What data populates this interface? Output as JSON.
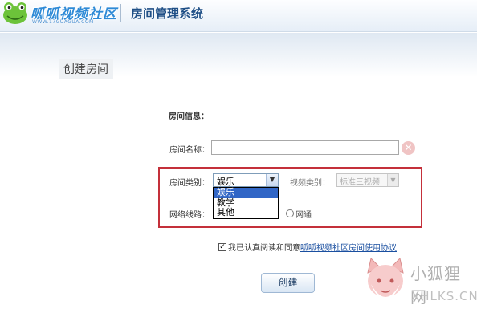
{
  "header": {
    "brand_name": "呱呱视频社区",
    "brand_url": "WWW.17GUAGUA.COM",
    "system_title": "房间管理系统"
  },
  "page": {
    "section_title": "创建房间"
  },
  "form": {
    "room_info_label": "房间信息：",
    "room_name_label": "房间名称：",
    "room_name_value": "",
    "room_category_label": "房间类别：",
    "room_category_value": "娱乐",
    "room_category_options": [
      "娱乐",
      "教学",
      "其他"
    ],
    "video_category_label": "视频类别：",
    "video_category_value": "标准三视频",
    "network_label": "网络线路：",
    "network_option_label": "网通"
  },
  "agreement": {
    "checked": true,
    "text": "我已认真阅读和同意",
    "link_text": "呱呱视频社区房间使用协议"
  },
  "buttons": {
    "create_label": "创建"
  },
  "watermark": {
    "text_cn": "小狐狸网",
    "text_en": "XHLKS.CN"
  },
  "colors": {
    "highlight_border": "#c4303a",
    "link": "#1a4fa0",
    "selected_option_bg": "#3166c6"
  },
  "icons": {
    "logo": "frog-logo-icon",
    "clear": "clear-x-icon",
    "dropdown": "chevron-down-icon"
  }
}
